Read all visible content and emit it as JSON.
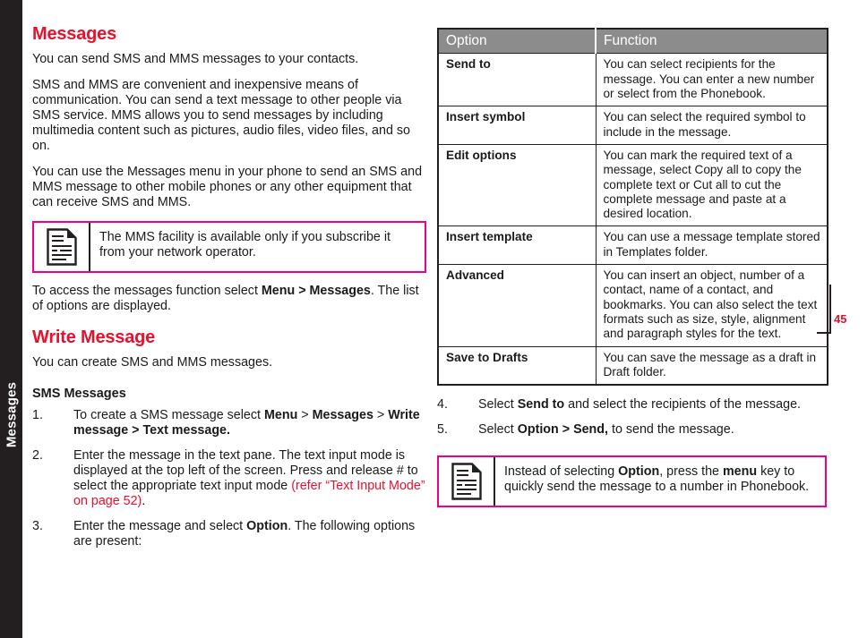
{
  "side_tab": {
    "label": "Messages"
  },
  "page_number": "45",
  "left_column": {
    "heading": "Messages",
    "intro_1": "You can send SMS and MMS messages to your contacts.",
    "intro_2": "SMS and MMS are convenient and inexpensive means of communication. You can send a text message to other people via SMS service. MMS allows you to send messages by including multimedia content such as pictures, audio files, video files, and so on.",
    "intro_3": "You can use the Messages menu in your phone to send an SMS and MMS message to other mobile phones or any other equipment that can receive SMS and MMS.",
    "note": {
      "icon": "note-document-icon",
      "text": "The MMS facility is available only if you subscribe it from your network operator."
    },
    "access_text_1": "To access the messages function select ",
    "access_bold_1": "Menu > Messages",
    "access_text_2": ". The list of options are displayed.",
    "write_heading": "Write Message",
    "write_intro": "You can create SMS and MMS messages.",
    "sms_heading": "SMS Messages",
    "steps": [
      {
        "num": "1.",
        "parts": [
          {
            "text": "To create a SMS message select ",
            "style": "normal"
          },
          {
            "text": "Menu",
            "style": "bold"
          },
          {
            "text": " > ",
            "style": "normal"
          },
          {
            "text": "Messages",
            "style": "bold"
          },
          {
            "text": " > ",
            "style": "normal"
          },
          {
            "text": "Write message > Text message.",
            "style": "bold"
          }
        ]
      },
      {
        "num": "2.",
        "parts": [
          {
            "text": "Enter the message in the text pane. The text input mode is displayed at the top left of the screen. Press and release # to select the appropriate text input mode ",
            "style": "normal"
          },
          {
            "text": "(refer “Text Input Mode” on page 52)",
            "style": "red"
          },
          {
            "text": ".",
            "style": "normal"
          }
        ]
      },
      {
        "num": "3.",
        "parts": [
          {
            "text": "Enter the message and select ",
            "style": "normal"
          },
          {
            "text": "Option",
            "style": "bold"
          },
          {
            "text": ". The following options are present:",
            "style": "normal"
          }
        ]
      }
    ]
  },
  "right_column": {
    "table": {
      "headers": [
        "Option",
        "Function"
      ],
      "rows": [
        {
          "option": "Send to",
          "function": "You can select recipients for the message. You can enter a new number or select from the Phonebook."
        },
        {
          "option": "Insert symbol",
          "function": "You can select the required symbol to include in the message."
        },
        {
          "option": "Edit options",
          "function": "You can mark the required text of a message, select Copy all to copy the complete text or Cut all to cut the complete message and paste at a desired location."
        },
        {
          "option": "Insert template",
          "function": "You can use a message template stored in Templates folder."
        },
        {
          "option": "Advanced",
          "function": "You can insert an object, number of a contact, name of a contact, and bookmarks. You can also select the text formats such as size, style, alignment and paragraph styles for the text."
        },
        {
          "option": "Save to Drafts",
          "function": "You can save the message as a draft in Draft folder."
        }
      ]
    },
    "steps": [
      {
        "num": "4.",
        "parts": [
          {
            "text": "Select ",
            "style": "normal"
          },
          {
            "text": "Send to",
            "style": "bold"
          },
          {
            "text": " and select the recipients of the message.",
            "style": "normal"
          }
        ]
      },
      {
        "num": "5.",
        "parts": [
          {
            "text": "Select ",
            "style": "normal"
          },
          {
            "text": "Option > Send,",
            "style": "bold"
          },
          {
            "text": " to send the message.",
            "style": "normal"
          }
        ]
      }
    ],
    "note": {
      "icon": "note-document-icon",
      "parts": [
        {
          "text": "Instead of selecting ",
          "style": "normal"
        },
        {
          "text": "Option",
          "style": "bold"
        },
        {
          "text": ", press the ",
          "style": "normal"
        },
        {
          "text": "menu",
          "style": "bold"
        },
        {
          "text": " key to quickly send the message to a number in Phonebook.",
          "style": "normal"
        }
      ]
    }
  },
  "colors": {
    "heading_red": "#e8112d",
    "note_border_magenta": "#ec008c",
    "table_header_gray": "#8c8c8c",
    "side_tab_black": "#231f20"
  }
}
